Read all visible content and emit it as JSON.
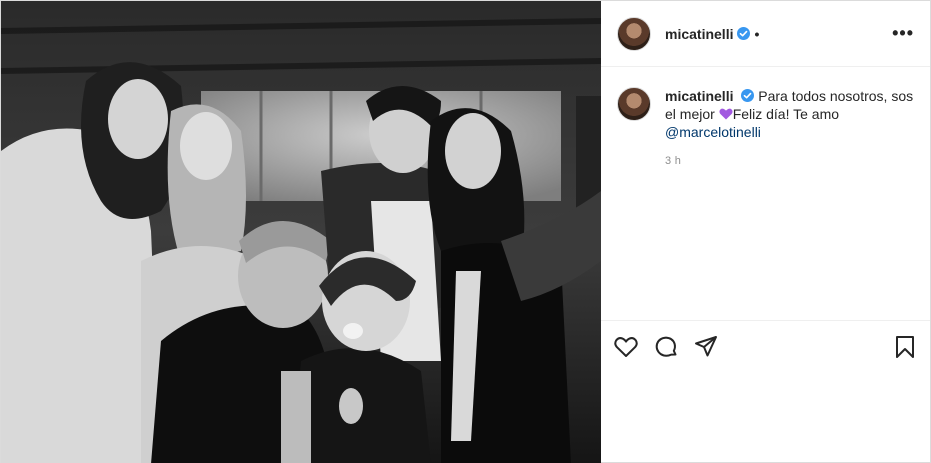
{
  "post": {
    "author": {
      "username": "micatinelli",
      "verified": true,
      "separator": "•"
    },
    "more_label": "•••",
    "caption": {
      "username": "micatinelli",
      "text_part1": "Para todos nosotros, sos el mejor ",
      "emoji": "purple-heart",
      "text_part2": "Feliz día! Te amo",
      "mention": "@marcelotinelli"
    },
    "timestamp": "3 h",
    "photo": {
      "description_icon": "photo",
      "palette": "black-and-white"
    },
    "actions": {
      "like_icon": "heart-outline-icon",
      "comment_icon": "comment-icon",
      "share_icon": "paper-plane-icon",
      "save_icon": "bookmark-icon"
    },
    "colors": {
      "verified": "#3897f0",
      "mention": "#00376b",
      "muted": "#8e8e8e",
      "emoji": "#a259e0"
    }
  }
}
